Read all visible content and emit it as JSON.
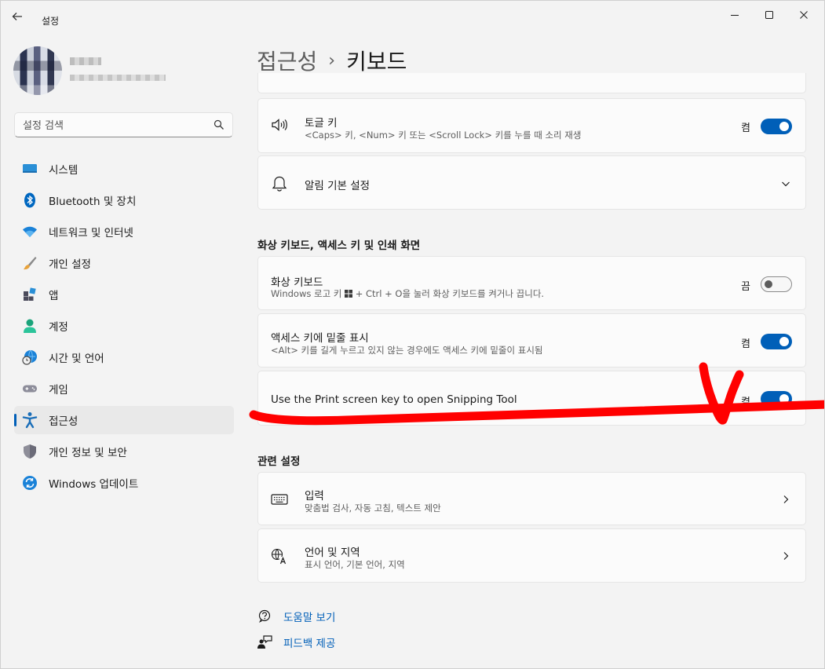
{
  "window": {
    "title": "설정"
  },
  "profile": {
    "name": "",
    "email": ""
  },
  "search": {
    "placeholder": "설정 검색"
  },
  "sidebar": {
    "items": [
      {
        "label": "시스템",
        "icon": "system-icon"
      },
      {
        "label": "Bluetooth 및 장치",
        "icon": "bluetooth-icon"
      },
      {
        "label": "네트워크 및 인터넷",
        "icon": "wifi-icon"
      },
      {
        "label": "개인 설정",
        "icon": "brush-icon"
      },
      {
        "label": "앱",
        "icon": "apps-icon"
      },
      {
        "label": "계정",
        "icon": "account-icon"
      },
      {
        "label": "시간 및 언어",
        "icon": "time-language-icon"
      },
      {
        "label": "게임",
        "icon": "gamepad-icon"
      },
      {
        "label": "접근성",
        "icon": "accessibility-icon",
        "active": true
      },
      {
        "label": "개인 정보 및 보안",
        "icon": "shield-icon"
      },
      {
        "label": "Windows 업데이트",
        "icon": "update-icon"
      }
    ]
  },
  "breadcrumb": {
    "parent": "접근성",
    "separator": "›",
    "current": "키보드"
  },
  "cards": {
    "toggle_keys": {
      "title": "토글 키",
      "desc": "<Caps> 키, <Num> 키 또는 <Scroll Lock> 키를 누를 때 소리 재생",
      "state": "켬",
      "on": true
    },
    "notification_prefs": {
      "title": "알림 기본 설정"
    },
    "onscreen_keyboard": {
      "title": "화상 키보드",
      "desc_before": "Windows 로고 키 ",
      "desc_after": " + Ctrl + O을 눌러 화상 키보드를 켜거나 끕니다.",
      "state": "끔",
      "on": false
    },
    "access_key_underline": {
      "title": "액세스 키에 밑줄 표시",
      "desc": "<Alt> 키를 길게 누르고 있지 않는 경우에도 액세스 키에 밑줄이 표시됨",
      "state": "켬",
      "on": true
    },
    "print_screen": {
      "title": "Use the Print screen key to open Snipping Tool",
      "state": "켬",
      "on": true
    },
    "input": {
      "title": "입력",
      "desc": "맞춤법 검사, 자동 고침, 텍스트 제안"
    },
    "language_region": {
      "title": "언어 및 지역",
      "desc": "표시 언어, 기본 언어, 지역"
    }
  },
  "sections": {
    "osk_heading": "화상 키보드, 액세스 키 및 인쇄 화면",
    "related_heading": "관련 설정"
  },
  "links": {
    "help": "도움말 보기",
    "feedback": "피드백 제공"
  },
  "colors": {
    "accent": "#005fb8",
    "annotation": "#ff0000"
  }
}
